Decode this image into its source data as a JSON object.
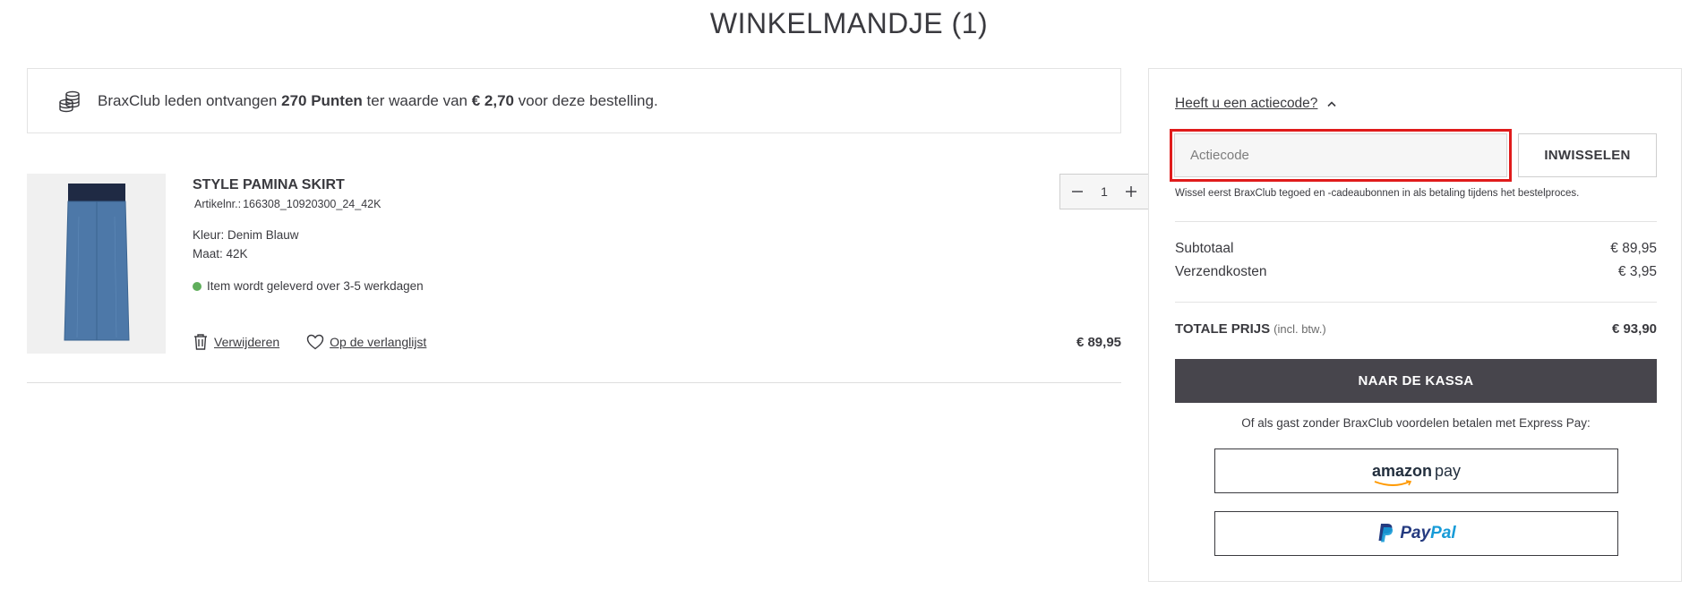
{
  "page": {
    "title": "WINKELMANDJE (1)"
  },
  "club_banner": {
    "text_prefix": "BraxClub leden ontvangen ",
    "points": "270 Punten",
    "text_middle": " ter waarde van ",
    "value": "€ 2,70",
    "text_suffix": " voor deze bestelling.",
    "icon": "coins-icon"
  },
  "product": {
    "name": "STYLE PAMINA SKIRT",
    "article_label": "Artikelnr.:",
    "article_nr": "166308_10920300_24_42K",
    "color": "Kleur: Denim Blauw",
    "size": "Maat: 42K",
    "delivery": "Item wordt geleverd over 3-5 werkdagen",
    "quantity": "1",
    "price": "€ 89,95",
    "remove_label": "Verwijderen",
    "wishlist_label": "Op de verlanglijst"
  },
  "summary": {
    "promo_toggle": "Heeft u een actiecode?",
    "promo_placeholder": "Actiecode",
    "redeem_label": "INWISSELEN",
    "promo_note": "Wissel eerst BraxClub tegoed en -cadeaubonnen in als betaling tijdens het bestelproces.",
    "subtotal_label": "Subtotaal",
    "subtotal_value": "€ 89,95",
    "shipping_label": "Verzendkosten",
    "shipping_value": "€ 3,95",
    "total_label": "TOTALE PRIJS",
    "total_incl": "(incl. btw.)",
    "total_value": "€ 93,90",
    "checkout_label": "NAAR DE KASSA",
    "express_note": "Of als gast zonder BraxClub voordelen betalen met Express Pay:",
    "amazon_main": "amazon",
    "amazon_pay": "pay",
    "paypal_part1": "Pay",
    "paypal_part2": "Pal"
  },
  "colors": {
    "text": "#3a3a3f",
    "checkout_bg": "#47454c",
    "highlight": "#e01b1b",
    "delivery_dot": "#5fae5b"
  }
}
